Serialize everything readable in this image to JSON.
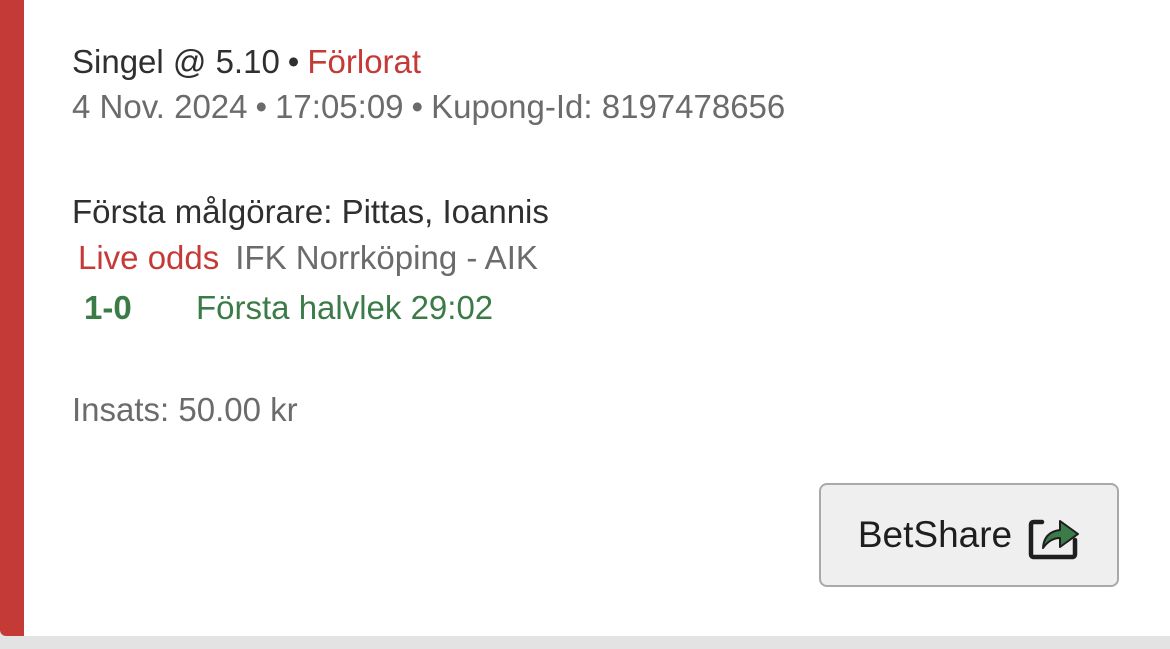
{
  "bet": {
    "type_label": "Singel @ 5.10",
    "separator": "•",
    "status": "Förlorat",
    "date": "4 Nov. 2024",
    "time": "17:05:09",
    "coupon_id": "Kupong-Id: 8197478656"
  },
  "selection": {
    "market": "Första målgörare: Pittas, Ioannis",
    "live_label": "Live odds",
    "event": "IFK Norrköping - AIK",
    "score": "1-0",
    "period": "Första halvlek 29:02"
  },
  "stake": {
    "label": "Insats: 50.00 kr"
  },
  "share_button": {
    "label": "BetShare",
    "icon": "share-icon"
  },
  "colors": {
    "lost": "#c43a37",
    "live": "#3b7b47",
    "share_icon": "#3b7b47"
  }
}
